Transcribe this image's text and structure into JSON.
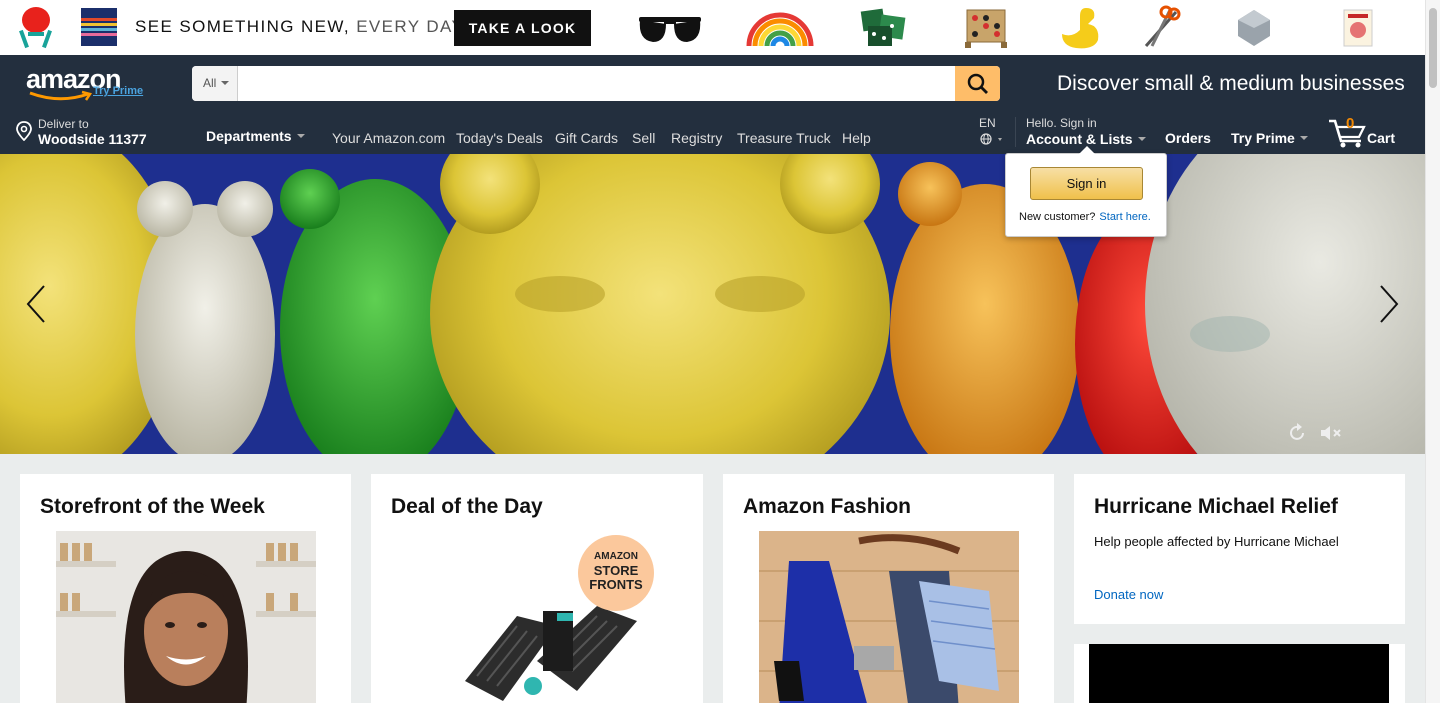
{
  "promo": {
    "headline_bold": "SEE SOMETHING NEW,",
    "headline_rest": "EVERY DAY.",
    "cta": "TAKE A LOOK",
    "thumb_icons": [
      "mushroom-stool-icon",
      "striped-blanket-icon",
      "sunglasses-icon",
      "rainbow-toy-icon",
      "pillows-icon",
      "connect-four-game-icon",
      "yellow-duck-icon",
      "scissors-icon",
      "smart-speaker-icon",
      "book-icon"
    ]
  },
  "header": {
    "logo_text": "amazon",
    "logo_sub": "Try Prime",
    "search": {
      "category": "All",
      "value": "",
      "placeholder": ""
    },
    "discover": "Discover small & medium businesses",
    "deliver": {
      "line1": "Deliver to",
      "line2": "Woodside 11377"
    },
    "departments": "Departments",
    "links": [
      "Your Amazon.com",
      "Today's Deals",
      "Gift Cards",
      "Sell",
      "Registry",
      "Treasure Truck",
      "Help"
    ],
    "language": "EN",
    "account": {
      "greeting": "Hello. Sign in",
      "label": "Account & Lists"
    },
    "orders": "Orders",
    "prime": "Try Prime",
    "cart": {
      "count": "0",
      "label": "Cart"
    }
  },
  "flyout": {
    "signin": "Sign in",
    "new_customer": "New customer?",
    "start_here": "Start here."
  },
  "cards": {
    "storefront": {
      "title": "Storefront of the Week"
    },
    "deal": {
      "title": "Deal of the Day",
      "badge_lines": [
        "AMAZON",
        "STORE",
        "FRONTS"
      ]
    },
    "fashion": {
      "title": "Amazon Fashion"
    },
    "hurricane": {
      "title": "Hurricane Michael Relief",
      "description": "Help people affected by Hurricane Michael",
      "link": "Donate now"
    }
  },
  "colors": {
    "nav_bg": "#232f3e",
    "search_button": "#febd69",
    "cart_count": "#f08804",
    "link": "#0066c0",
    "page_bg": "#eaeded"
  }
}
